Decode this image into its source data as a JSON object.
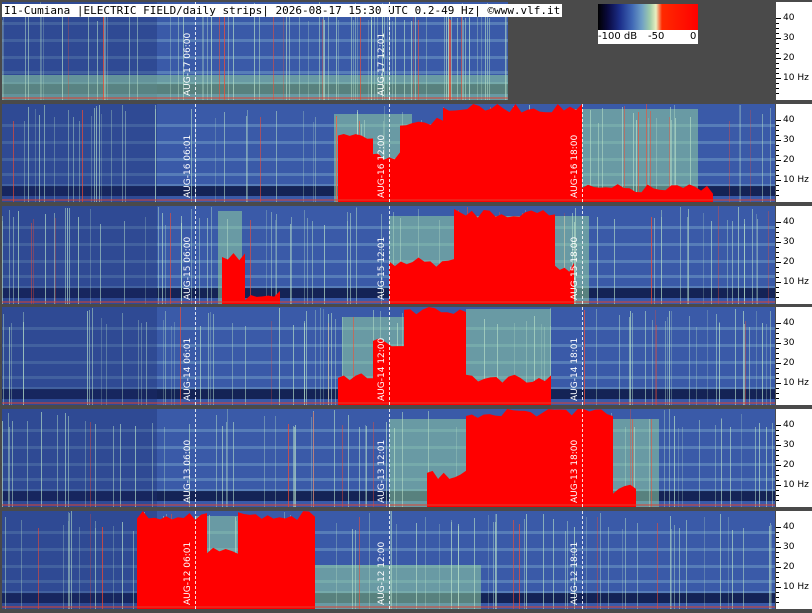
{
  "header": "I1-Cumiana |ELECTRIC FIELD/daily strips| 2026-08-17 15:30 UTC 0.2-49 Hz| ©www.vlf.it",
  "legend": {
    "min_label": "-100 dB",
    "mid_label": "-50",
    "max_label": "0"
  },
  "axis_ticks": [
    "40",
    "30",
    "20",
    "10 Hz"
  ],
  "colors": {
    "background": "#4a4a4a",
    "base": "#3a5aa8",
    "burst": "#ff0000",
    "green": "#8fd0a0"
  },
  "strips": [
    {
      "date": "AUG-17",
      "marks": [
        {
          "time": "06:00",
          "pos": 0.25
        },
        {
          "time": "12:01",
          "pos": 0.5
        }
      ],
      "end": 0.655,
      "bursts": [],
      "green": [
        [
          0.0,
          0.66,
          0.25
        ]
      ]
    },
    {
      "date": "AUG-16",
      "marks": [
        {
          "time": "06:01",
          "pos": 0.25
        },
        {
          "time": "12:00",
          "pos": 0.5
        },
        {
          "time": "18:00",
          "pos": 0.75
        }
      ],
      "end": 1.0,
      "bursts": [
        [
          0.435,
          0.48,
          0.7
        ],
        [
          0.48,
          0.515,
          0.5
        ],
        [
          0.515,
          0.57,
          0.85
        ],
        [
          0.57,
          0.75,
          0.98
        ],
        [
          0.75,
          0.92,
          0.15
        ]
      ],
      "green": [
        [
          0.43,
          0.53,
          0.9
        ],
        [
          0.74,
          0.9,
          0.95
        ]
      ]
    },
    {
      "date": "AUG-15",
      "marks": [
        {
          "time": "06:00",
          "pos": 0.25
        },
        {
          "time": "12:01",
          "pos": 0.5
        },
        {
          "time": "18:00",
          "pos": 0.75
        }
      ],
      "end": 1.0,
      "bursts": [
        [
          0.285,
          0.315,
          0.5
        ],
        [
          0.315,
          0.36,
          0.1
        ],
        [
          0.5,
          0.585,
          0.45
        ],
        [
          0.585,
          0.715,
          0.95
        ],
        [
          0.715,
          0.74,
          0.4
        ]
      ],
      "green": [
        [
          0.28,
          0.31,
          0.95
        ],
        [
          0.5,
          0.76,
          0.9
        ]
      ]
    },
    {
      "date": "AUG-14",
      "marks": [
        {
          "time": "06:01",
          "pos": 0.25
        },
        {
          "time": "12:00",
          "pos": 0.5
        },
        {
          "time": "18:01",
          "pos": 0.75
        }
      ],
      "end": 1.0,
      "bursts": [
        [
          0.435,
          0.48,
          0.3
        ],
        [
          0.48,
          0.52,
          0.65
        ],
        [
          0.52,
          0.6,
          0.98
        ],
        [
          0.6,
          0.71,
          0.3
        ]
      ],
      "green": [
        [
          0.44,
          0.52,
          0.9
        ],
        [
          0.6,
          0.71,
          0.98
        ]
      ]
    },
    {
      "date": "AUG-13",
      "marks": [
        {
          "time": "06:00",
          "pos": 0.25
        },
        {
          "time": "12:01",
          "pos": 0.5
        },
        {
          "time": "18:00",
          "pos": 0.75
        }
      ],
      "end": 1.0,
      "bursts": [
        [
          0.55,
          0.6,
          0.35
        ],
        [
          0.6,
          0.79,
          0.98
        ],
        [
          0.79,
          0.82,
          0.2
        ]
      ],
      "green": [
        [
          0.5,
          0.6,
          0.9
        ],
        [
          0.79,
          0.85,
          0.9
        ]
      ]
    },
    {
      "date": "AUG-12",
      "marks": [
        {
          "time": "06:01",
          "pos": 0.25
        },
        {
          "time": "12:00",
          "pos": 0.5
        },
        {
          "time": "18:01",
          "pos": 0.75
        }
      ],
      "end": 1.0,
      "bursts": [
        [
          0.175,
          0.265,
          0.98
        ],
        [
          0.265,
          0.305,
          0.6
        ],
        [
          0.305,
          0.405,
          0.98
        ]
      ],
      "green": [
        [
          0.25,
          0.31,
          0.95
        ],
        [
          0.4,
          0.62,
          0.45
        ]
      ]
    }
  ]
}
